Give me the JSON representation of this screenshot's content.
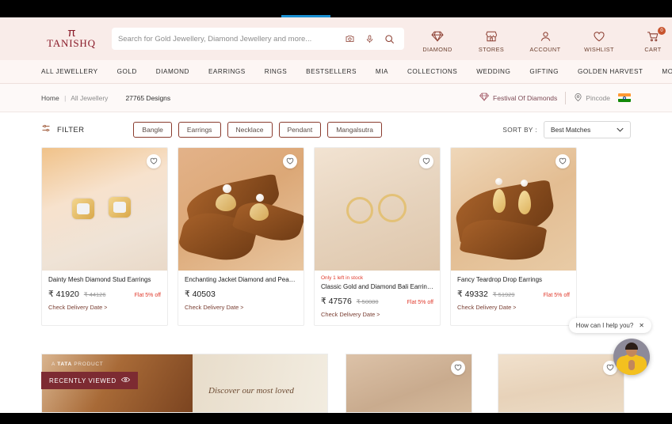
{
  "brand": {
    "logo_mark": "π",
    "logo_text": "TANISHQ"
  },
  "search": {
    "placeholder": "Search for Gold Jewellery, Diamond Jewellery and more...",
    "value": "",
    "camera_icon": "camera-icon",
    "mic_icon": "microphone-icon",
    "search_icon": "search-icon"
  },
  "header_actions": [
    {
      "label": "DIAMOND",
      "icon": "diamond-icon"
    },
    {
      "label": "STORES",
      "icon": "store-icon"
    },
    {
      "label": "ACCOUNT",
      "icon": "account-icon"
    },
    {
      "label": "WISHLIST",
      "icon": "heart-icon"
    },
    {
      "label": "CART",
      "icon": "cart-icon",
      "badge": "0"
    }
  ],
  "nav": {
    "items": [
      {
        "label": "ALL JEWELLERY"
      },
      {
        "label": "GOLD"
      },
      {
        "label": "DIAMOND"
      },
      {
        "label": "EARRINGS"
      },
      {
        "label": "RINGS"
      },
      {
        "label": "BESTSELLERS"
      },
      {
        "label": "MIA"
      },
      {
        "label": "COLLECTIONS"
      },
      {
        "label": "WEDDING"
      },
      {
        "label": "GIFTING"
      },
      {
        "label": "GOLDEN HARVEST"
      },
      {
        "label": "MORE"
      }
    ]
  },
  "breadcrumb": {
    "home": "Home",
    "separator": "|",
    "current": "All Jewellery",
    "designs_count": "27765 Designs",
    "festival_label": "Festival Of Diamonds",
    "festival_icon": "diamond-icon",
    "pincode_label": "Pincode",
    "pincode_icon": "location-pin-icon",
    "flag_icon": "india-flag-icon"
  },
  "filter": {
    "label": "FILTER",
    "icon": "filter-sliders-icon",
    "chips": [
      {
        "label": "Bangle"
      },
      {
        "label": "Earrings"
      },
      {
        "label": "Necklace"
      },
      {
        "label": "Pendant"
      },
      {
        "label": "Mangalsutra"
      }
    ],
    "sort_label": "SORT BY :",
    "sort_value": "Best Matches",
    "sort_chevron": "chevron-down-icon"
  },
  "products": [
    {
      "name": "Dainty Mesh Diamond Stud Earrings",
      "price": "₹ 41920",
      "mrp": "₹ 44126",
      "offer": "Flat 5% off",
      "stock_note": "",
      "delivery": "Check Delivery Date",
      "wish_icon": "heart-outline-icon"
    },
    {
      "name": "Enchanting Jacket Diamond and Pearl ...",
      "price": "₹ 40503",
      "mrp": "",
      "offer": "",
      "stock_note": "",
      "delivery": "Check Delivery Date",
      "wish_icon": "heart-outline-icon"
    },
    {
      "name": "Classic Gold and Diamond Bali Earrings",
      "price": "₹ 47576",
      "mrp": "₹ 50080",
      "offer": "Flat 5% off",
      "stock_note": "Only 1 left in stock",
      "delivery": "Check Delivery Date",
      "wish_icon": "heart-outline-icon"
    },
    {
      "name": "Fancy Teardrop Drop Earrings",
      "price": "₹ 49332",
      "mrp": "₹ 51929",
      "offer": "Flat 5% off",
      "stock_note": "",
      "delivery": "Check Delivery Date",
      "wish_icon": "heart-outline-icon"
    }
  ],
  "banner": {
    "tata_prefix": "A ",
    "tata_brand": "TATA",
    "tata_suffix": " PRODUCT",
    "copy": "Discover our most loved"
  },
  "recently_viewed": {
    "label": "RECENTLY VIEWED",
    "icon": "eye-icon"
  },
  "chat": {
    "message": "How can I help you?",
    "close": "✕",
    "avatar_icon": "assistant-avatar-icon"
  },
  "colors": {
    "brand_maroon": "#8a1c2a",
    "header_bg": "#f9ece9",
    "chip_border": "#8a3b2e",
    "offer_red": "#e0392b",
    "progress_blue": "#1a8fd1"
  }
}
